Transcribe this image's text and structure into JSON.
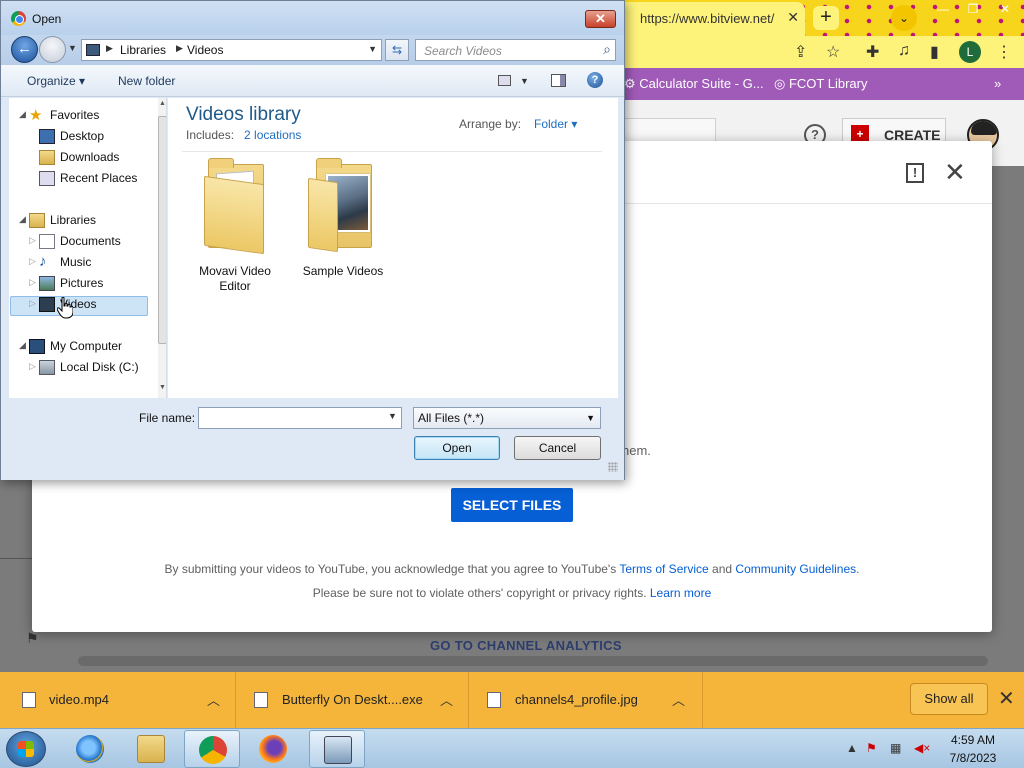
{
  "browser": {
    "tab_url": "https://www.bitview.net/",
    "tab_close": "✕",
    "new_tab": "+",
    "profile_initial": "L",
    "bookmarks": [
      "Calculator Suite - G...",
      "FCOT Library"
    ],
    "bookmarks_more": "»"
  },
  "youtube": {
    "create_label": "CREATE",
    "help": "?",
    "feedback": "!",
    "close": "✕",
    "partial_heading": "l",
    "partial_text": "hem.",
    "select_files": "SELECT FILES",
    "terms_prefix": "By submitting your videos to YouTube, you acknowledge that you agree to YouTube's ",
    "terms_link": "Terms of Service",
    "terms_and": " and ",
    "guidelines_link": "Community Guidelines",
    "terms_suffix": ".",
    "privacy_prefix": "Please be sure not to violate others' copyright or privacy rights. ",
    "learn_more": "Learn more",
    "channel_analytics": "GO TO CHANNEL ANALYTICS"
  },
  "downloads": {
    "items": [
      {
        "name": "video.mp4"
      },
      {
        "name": "Butterfly On Deskt....exe"
      },
      {
        "name": "channels4_profile.jpg"
      }
    ],
    "show_all": "Show all",
    "close": "✕"
  },
  "taskbar": {
    "time": "4:59 AM",
    "date": "7/8/2023"
  },
  "dialog": {
    "title": "Open",
    "close": "✕",
    "breadcrumb": [
      "Libraries",
      "Videos"
    ],
    "search_placeholder": "Search Videos",
    "organize": "Organize ▾",
    "new_folder": "New folder",
    "help": "?",
    "nav": {
      "favorites": "Favorites",
      "desktop": "Desktop",
      "downloads": "Downloads",
      "recent_places": "Recent Places",
      "libraries": "Libraries",
      "documents": "Documents",
      "music": "Music",
      "pictures": "Pictures",
      "videos": "Videos",
      "my_computer": "My Computer",
      "local_disk": "Local Disk (C:)"
    },
    "library_title": "Videos library",
    "includes_label": "Includes:",
    "includes_link": "2 locations",
    "arrange_label": "Arrange by:",
    "arrange_value": "Folder ▾",
    "folders": [
      {
        "line1": "Movavi Video",
        "line2": "Editor"
      },
      {
        "line1": "Sample Videos",
        "line2": ""
      }
    ],
    "file_name_label": "File name:",
    "file_name_value": "",
    "filter_value": "All Files (*.*)",
    "open_button": "Open",
    "cancel_button": "Cancel"
  },
  "colors": {
    "accent": "#065fd4",
    "download_bar": "#f5b53a",
    "library_title": "#1e5a8a"
  }
}
